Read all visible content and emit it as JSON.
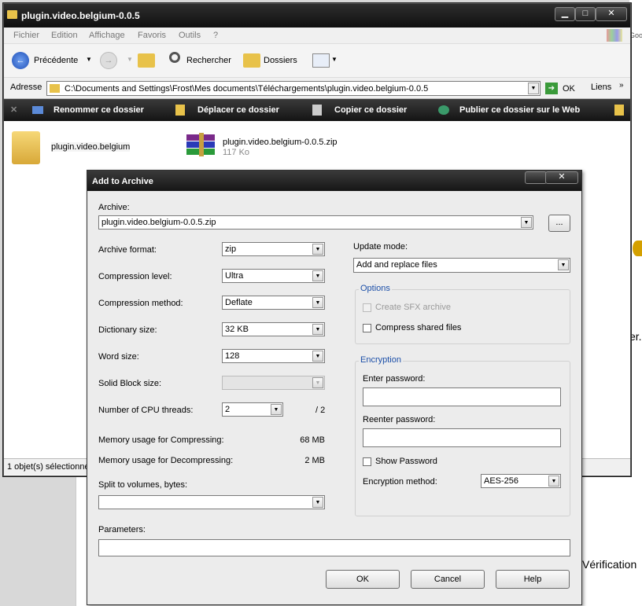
{
  "explorer": {
    "title": "plugin.video.belgium-0.0.5",
    "menu": [
      "Fichier",
      "Edition",
      "Affichage",
      "Favoris",
      "Outils",
      "?"
    ],
    "toolbar": {
      "back": "Précédente",
      "search": "Rechercher",
      "folders": "Dossiers"
    },
    "address": {
      "label": "Adresse",
      "value": "C:\\Documents and Settings\\Frost\\Mes documents\\Téléchargements\\plugin.video.belgium-0.0.5",
      "go": "OK",
      "links": "Liens"
    },
    "tasks": [
      "Renommer ce dossier",
      "Déplacer ce dossier",
      "Copier ce dossier",
      "Publier ce dossier sur le Web"
    ],
    "files": [
      {
        "name": "plugin.video.belgium",
        "icon": "folder-icon"
      },
      {
        "name": "plugin.video.belgium-0.0.5.zip",
        "size": "117 Ko",
        "icon": "rar-archive-icon"
      }
    ],
    "status": "1 objet(s) sélectionné"
  },
  "background": {
    "partial_text_1": "er.",
    "partial_text_2": "Vérification",
    "partial_google": "Goo"
  },
  "dialog": {
    "title": "Add to Archive",
    "archive_label": "Archive:",
    "archive_value": "plugin.video.belgium-0.0.5.zip",
    "browse": "...",
    "format_label": "Archive format:",
    "format_value": "zip",
    "level_label": "Compression level:",
    "level_value": "Ultra",
    "method_label": "Compression method:",
    "method_value": "Deflate",
    "dict_label": "Dictionary size:",
    "dict_value": "32 KB",
    "word_label": "Word size:",
    "word_value": "128",
    "solid_label": "Solid Block size:",
    "solid_value": "",
    "threads_label": "Number of CPU threads:",
    "threads_value": "2",
    "threads_max": "/ 2",
    "mem_comp_label": "Memory usage for Compressing:",
    "mem_comp_value": "68 MB",
    "mem_decomp_label": "Memory usage for Decompressing:",
    "mem_decomp_value": "2 MB",
    "split_label": "Split to volumes, bytes:",
    "split_value": "",
    "params_label": "Parameters:",
    "params_value": "",
    "update_label": "Update mode:",
    "update_value": "Add and replace files",
    "options_legend": "Options",
    "sfx_label": "Create SFX archive",
    "shared_label": "Compress shared files",
    "enc_legend": "Encryption",
    "enter_pw_label": "Enter password:",
    "reenter_pw_label": "Reenter password:",
    "show_pw_label": "Show Password",
    "enc_method_label": "Encryption method:",
    "enc_method_value": "AES-256",
    "ok": "OK",
    "cancel": "Cancel",
    "help": "Help"
  }
}
